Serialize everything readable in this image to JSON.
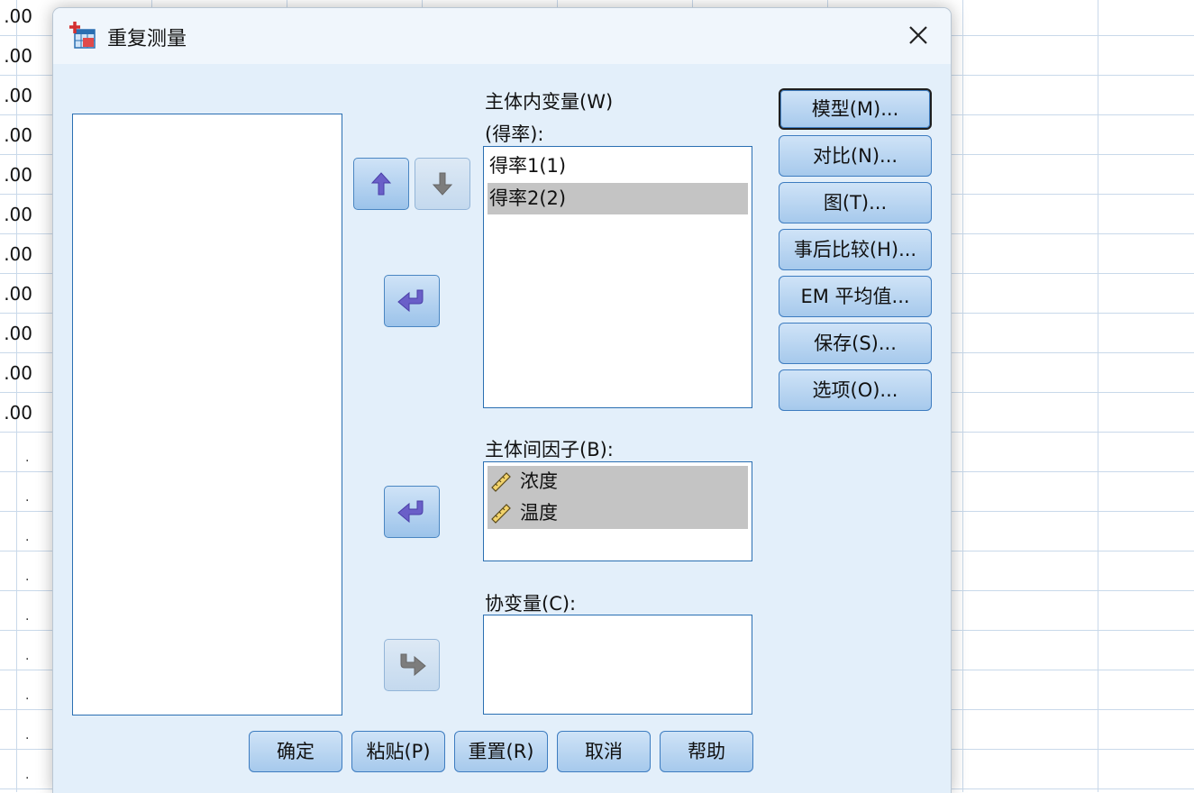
{
  "window": {
    "title": "重复测量"
  },
  "background_sheet": {
    "values": [
      ".00",
      ".00",
      ".00",
      ".00",
      ".00",
      ".00",
      ".00",
      ".00",
      ".00",
      ".00",
      ".00"
    ],
    "empty_marker": "."
  },
  "within_subjects": {
    "label": "主体内变量(W)",
    "sublabel": "(得率):",
    "items": [
      {
        "label": "得率1(1)",
        "selected": false
      },
      {
        "label": "得率2(2)",
        "selected": true
      }
    ]
  },
  "between_factors": {
    "label": "主体间因子(B):",
    "items": [
      {
        "label": "浓度",
        "icon": "ruler-icon",
        "selected": true
      },
      {
        "label": "温度",
        "icon": "ruler-icon",
        "selected": true
      }
    ]
  },
  "covariates": {
    "label": "协变量(C):"
  },
  "side_buttons": {
    "model": "模型(M)...",
    "contrast": "对比(N)...",
    "plots": "图(T)...",
    "posthoc": "事后比较(H)...",
    "em_means": "EM 平均值...",
    "save": "保存(S)...",
    "options": "选项(O)..."
  },
  "bottom_buttons": {
    "ok": "确定",
    "paste": "粘贴(P)",
    "reset": "重置(R)",
    "cancel": "取消",
    "help": "帮助"
  },
  "colors": {
    "dialog_bg": "#e3effa",
    "button_top": "#cfe3f7",
    "button_bottom": "#a6c9ec",
    "arrow_active": "#6a5fc8",
    "arrow_disabled": "#7d7d7d",
    "selection": "#c4c4c4"
  }
}
